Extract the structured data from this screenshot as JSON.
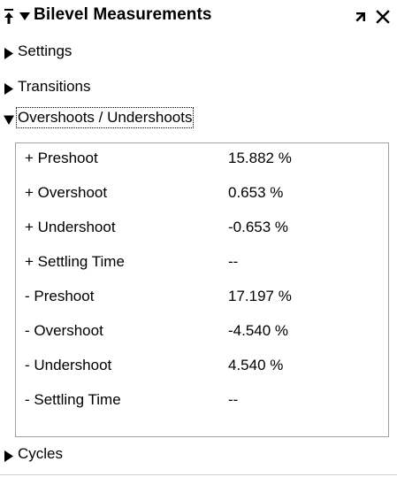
{
  "panel": {
    "title": "Bilevel Measurements",
    "icons": {
      "pin": "pin-icon",
      "title_caret": "caret-down-icon",
      "undock": "undock-arrow-icon",
      "close": "close-icon"
    }
  },
  "sections": {
    "settings": {
      "label": "Settings",
      "expanded": false
    },
    "transitions": {
      "label": "Transitions",
      "expanded": false
    },
    "overshoots": {
      "label": "Overshoots / Undershoots",
      "expanded": true
    },
    "cycles": {
      "label": "Cycles",
      "expanded": false
    }
  },
  "measurements": {
    "rows": [
      {
        "name": "+ Preshoot",
        "value": "15.882 %"
      },
      {
        "name": "+ Overshoot",
        "value": "0.653 %"
      },
      {
        "name": "+ Undershoot",
        "value": "-0.653 %"
      },
      {
        "name": "+ Settling Time",
        "value": "--"
      },
      {
        "name": "- Preshoot",
        "value": "17.197 %"
      },
      {
        "name": "- Overshoot",
        "value": "-4.540 %"
      },
      {
        "name": "- Undershoot",
        "value": "4.540 %"
      },
      {
        "name": "- Settling Time",
        "value": "--"
      }
    ]
  },
  "colors": {
    "text": "#000000",
    "box_border": "#a0a0a0",
    "background": "#ffffff"
  }
}
